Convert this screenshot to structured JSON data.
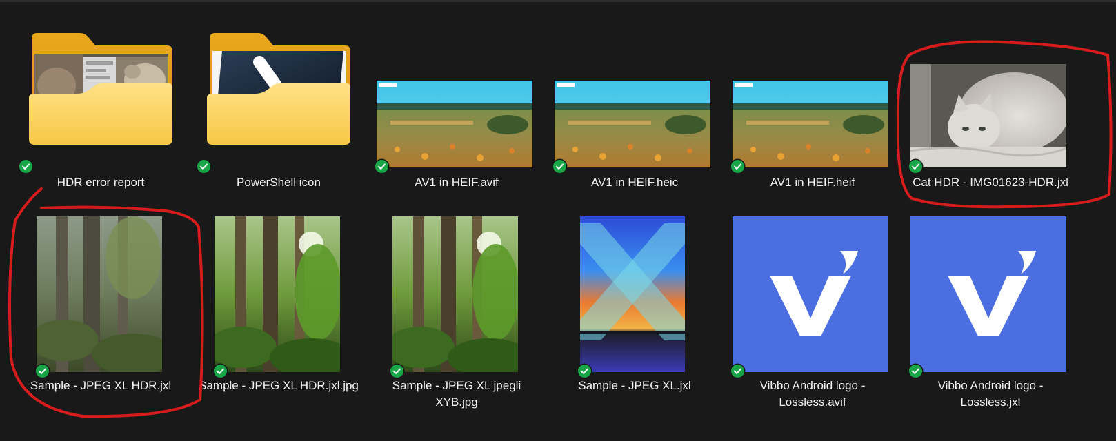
{
  "files": [
    {
      "name": "HDR error report",
      "kind": "folder",
      "preview": "cat-photo-screenshot",
      "status": "synced"
    },
    {
      "name": "PowerShell icon",
      "kind": "folder",
      "preview": "powershell-logo",
      "status": "synced"
    },
    {
      "name": "AV1 in HEIF.avif",
      "kind": "image",
      "preview": "meadow-landscape",
      "status": "synced"
    },
    {
      "name": "AV1 in HEIF.heic",
      "kind": "image",
      "preview": "meadow-landscape",
      "status": "synced"
    },
    {
      "name": "AV1 in HEIF.heif",
      "kind": "image",
      "preview": "meadow-landscape",
      "status": "synced"
    },
    {
      "name": "Cat HDR - IMG01623-HDR.jxl",
      "kind": "image",
      "preview": "white-cat",
      "status": "synced"
    },
    {
      "name": "Sample - JPEG XL HDR.jxl",
      "kind": "image",
      "preview": "forest-muted",
      "status": "synced"
    },
    {
      "name": "Sample - JPEG XL HDR.jxl.jpg",
      "kind": "image",
      "preview": "forest",
      "status": "synced"
    },
    {
      "name_line1": "Sample - JPEG XL jpegli",
      "name_line2": "XYB.jpg",
      "kind": "image",
      "preview": "forest",
      "status": "synced"
    },
    {
      "name": "Sample - JPEG XL.jxl",
      "kind": "image",
      "preview": "jpeg-xl-logo-sunset",
      "status": "synced"
    },
    {
      "name_line1": "Vibbo Android logo -",
      "name_line2": "Lossless.avif",
      "kind": "image",
      "preview": "vibbo-logo",
      "status": "synced"
    },
    {
      "name_line1": "Vibbo Android logo -",
      "name_line2": "Lossless.jxl",
      "kind": "image",
      "preview": "vibbo-logo",
      "status": "synced"
    }
  ],
  "icons": {
    "sync_status": "check-circle-icon"
  },
  "colors": {
    "background": "#191919",
    "sync_green": "#19a648",
    "annotation_red": "#d61c1c",
    "folder_yellow": "#f6c33f",
    "vibbo_blue": "#4b6fe0"
  }
}
